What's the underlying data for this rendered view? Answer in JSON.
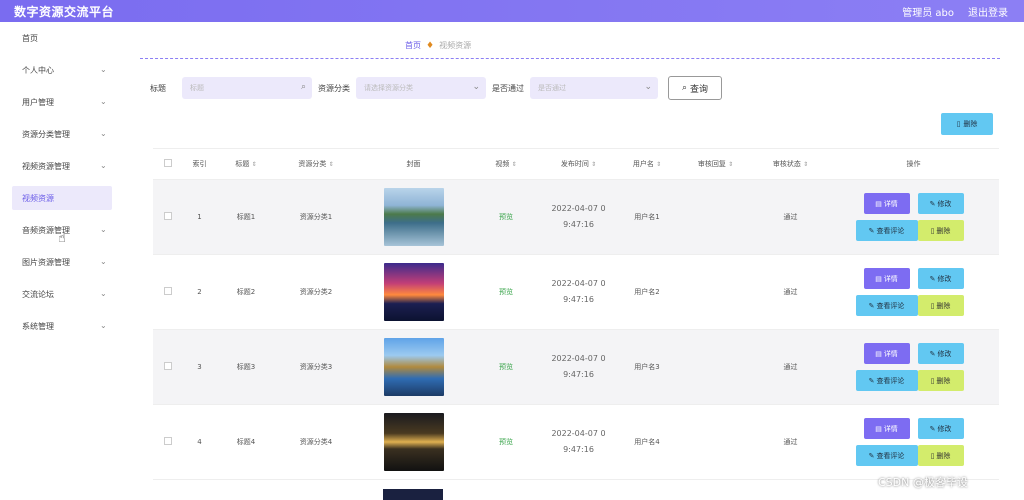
{
  "header": {
    "title": "数字资源交流平台",
    "admin": "管理员 abo",
    "logout": "退出登录"
  },
  "sidebar": {
    "items": [
      {
        "label": "首页",
        "chevron": false
      },
      {
        "label": "个人中心",
        "chevron": true
      },
      {
        "label": "用户管理",
        "chevron": true
      },
      {
        "label": "资源分类管理",
        "chevron": true
      },
      {
        "label": "视频资源管理",
        "chevron": true
      },
      {
        "label": "视频资源",
        "chevron": false,
        "active": true
      },
      {
        "label": "音频资源管理",
        "chevron": true
      },
      {
        "label": "图片资源管理",
        "chevron": true
      },
      {
        "label": "交流论坛",
        "chevron": true
      },
      {
        "label": "系统管理",
        "chevron": true
      }
    ]
  },
  "breadcrumb": {
    "home": "首页",
    "current": "视频资源"
  },
  "filters": {
    "title_label": "标题",
    "title_placeholder": "标题",
    "cat_label": "资源分类",
    "cat_placeholder": "请选择资源分类",
    "audit_label": "是否通过",
    "audit_placeholder": "是否通过",
    "query": "查询"
  },
  "actions": {
    "delete_all": "删除"
  },
  "table": {
    "headers": {
      "index": "索引",
      "title": "标题",
      "category": "资源分类",
      "cover": "封面",
      "video": "视频",
      "time": "发布时间",
      "user": "用户名",
      "reply": "审核回复",
      "status": "审核状态",
      "ops": "操作"
    },
    "rows": [
      {
        "index": "1",
        "title": "标题1",
        "category": "资源分类1",
        "video": "预览",
        "time1": "2022-04-07 0",
        "time2": "9:47:16",
        "user": "用户名1",
        "reply": "",
        "status": "通过",
        "thumb": "lake"
      },
      {
        "index": "2",
        "title": "标题2",
        "category": "资源分类2",
        "video": "预览",
        "time1": "2022-04-07 0",
        "time2": "9:47:16",
        "user": "用户名2",
        "reply": "",
        "status": "通过",
        "thumb": "sunset"
      },
      {
        "index": "3",
        "title": "标题3",
        "category": "资源分类3",
        "video": "预览",
        "time1": "2022-04-07 0",
        "time2": "9:47:16",
        "user": "用户名3",
        "reply": "",
        "status": "通过",
        "thumb": "road"
      },
      {
        "index": "4",
        "title": "标题4",
        "category": "资源分类4",
        "video": "预览",
        "time1": "2022-04-07 0",
        "time2": "9:47:16",
        "user": "用户名4",
        "reply": "",
        "status": "通过",
        "thumb": "sea"
      }
    ],
    "buttons": {
      "detail": "详情",
      "edit": "修改",
      "comments": "查看评论",
      "delete": "删除"
    }
  },
  "watermark": "CSDN @极客毕设",
  "colors": {
    "accent": "#7a6cf0",
    "info": "#62c8f2",
    "warn": "#d3ec6c",
    "success": "#3aa54b"
  }
}
